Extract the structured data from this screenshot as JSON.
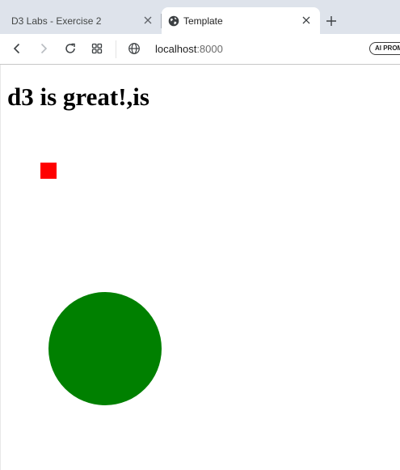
{
  "browser": {
    "tabs": [
      {
        "title": "D3 Labs - Exercise 2",
        "active": false
      },
      {
        "title": "Template",
        "active": true
      }
    ],
    "url_host": "localhost",
    "url_port": ":8000",
    "ai_button_label": "AI PROM"
  },
  "page": {
    "heading": "d3 is great!,is"
  },
  "shapes": {
    "square_color": "#ff0000",
    "circle_color": "#008000"
  }
}
